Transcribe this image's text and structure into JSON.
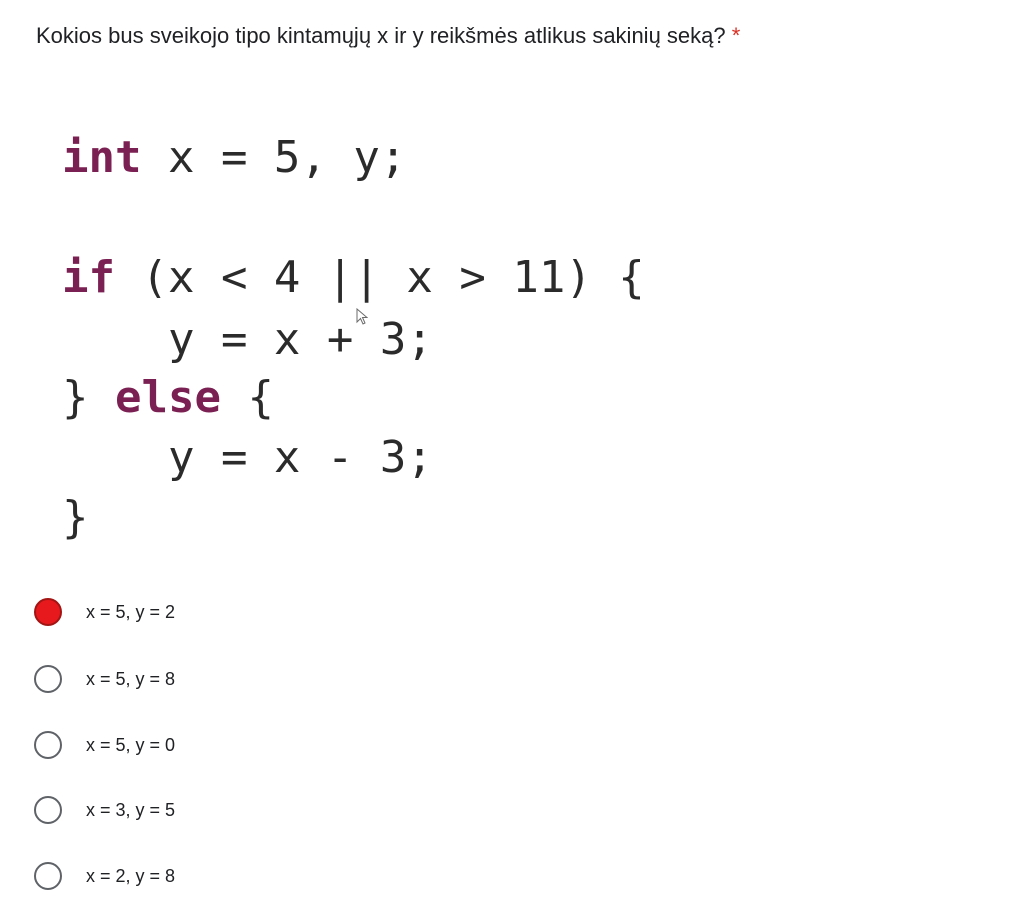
{
  "question": {
    "text": "Kokios bus sveikojo tipo kintamųjų x ir y reikšmės atlikus sakinių seką?",
    "required_marker": "*"
  },
  "code": {
    "line1": {
      "kw": "int",
      "rest": " x = 5, y;"
    },
    "line2": {
      "kw": "if",
      "rest": " (x < 4 || x > 11) {"
    },
    "line3": {
      "text": "    y = x + 3;"
    },
    "line4": {
      "pre": "} ",
      "kw": "else",
      "post": " {"
    },
    "line5": {
      "text": "    y = x - 3;"
    },
    "line6": {
      "text": "}"
    }
  },
  "options": [
    {
      "label": "x = 5, y = 2",
      "selected": true
    },
    {
      "label": "x = 5, y = 8",
      "selected": false
    },
    {
      "label": "x = 5, y = 0",
      "selected": false
    },
    {
      "label": "x = 3, y = 5",
      "selected": false
    },
    {
      "label": "x = 2, y = 8",
      "selected": false
    }
  ],
  "colors": {
    "keyword": "#7b2052",
    "selected_radio": "#e8191d",
    "required_star": "#d93025"
  }
}
